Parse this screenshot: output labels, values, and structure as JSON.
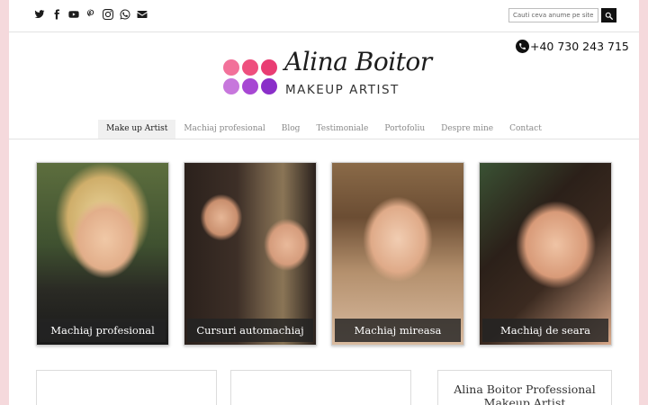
{
  "social": [
    "twitter-icon",
    "facebook-icon",
    "youtube-icon",
    "pinterest-icon",
    "instagram-icon",
    "whatsapp-icon",
    "envelope-icon"
  ],
  "search": {
    "placeholder": "Cauti ceva anume pe site?"
  },
  "phone": "+40 730 243 715",
  "brand": {
    "name": "Alina Boitor",
    "tagline": "MAKEUP ARTIST",
    "dot_colors": [
      "#f2719a",
      "#ee4f7e",
      "#e93d73",
      "#c777dc",
      "#a747d3",
      "#8a2fc9"
    ]
  },
  "nav": {
    "items": [
      "Make up Artist",
      "Machiaj profesional",
      "Blog",
      "Testimoniale",
      "Portofoliu",
      "Despre mine",
      "Contact"
    ],
    "active": "Make up Artist"
  },
  "cards": [
    {
      "caption": "Machiaj profesional"
    },
    {
      "caption": "Cursuri automachiaj"
    },
    {
      "caption": "Machiaj mireasa"
    },
    {
      "caption": "Machiaj de seara"
    }
  ],
  "sidebar_box": {
    "title": "Alina Boitor Professional Makeup Artist"
  },
  "colors": {
    "page_bg": "#f5d9dc",
    "caption_bg": "#232323"
  }
}
